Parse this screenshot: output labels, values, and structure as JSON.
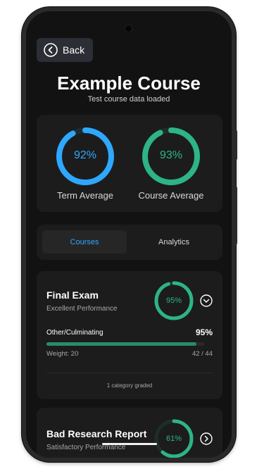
{
  "back_button": {
    "label": "Back"
  },
  "course": {
    "title": "Example Course",
    "subtitle": "Test course data loaded"
  },
  "averages": {
    "term": {
      "value": "92%",
      "label": "Term Average",
      "fraction": 0.92,
      "color": "#2ea8ff"
    },
    "course": {
      "value": "93%",
      "label": "Course Average",
      "fraction": 0.93,
      "color": "#2db487"
    }
  },
  "tabs": [
    {
      "label": "Courses",
      "active": true
    },
    {
      "label": "Analytics",
      "active": false
    }
  ],
  "grades": [
    {
      "title": "Final Exam",
      "subtitle": "Excellent Performance",
      "score": "95%",
      "fraction": 0.95,
      "ring_color": "#2db487",
      "expanded": true,
      "category": {
        "name": "Other/Culminating",
        "percent": "95%",
        "fraction": 0.95,
        "weight": "Weight: 20",
        "points": "42 / 44"
      },
      "graded_note": "1 category graded"
    },
    {
      "title": "Bad Research Report",
      "subtitle": "Satisfactory Performance",
      "score": "61%",
      "fraction": 0.61,
      "ring_color": "#2db487",
      "expanded": false
    }
  ]
}
